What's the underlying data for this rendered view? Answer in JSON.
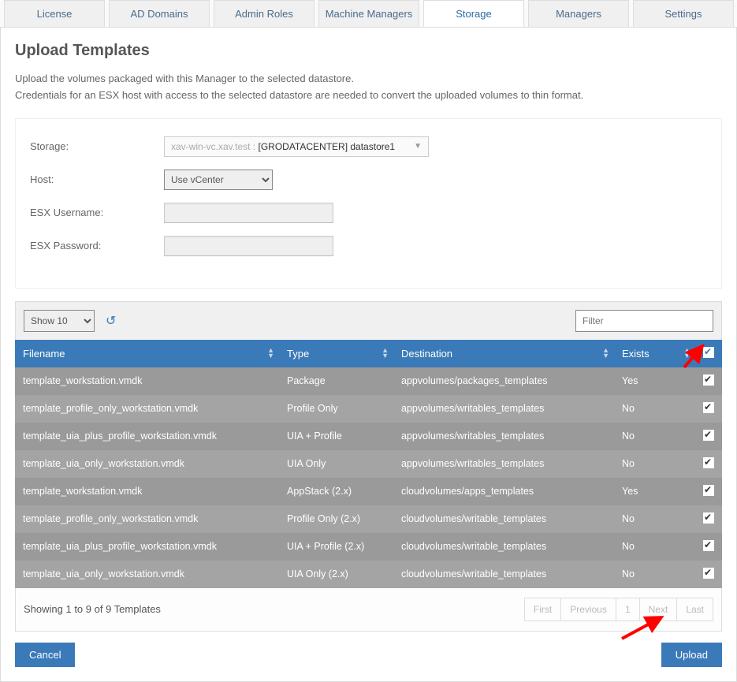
{
  "tabs": [
    "License",
    "AD Domains",
    "Admin Roles",
    "Machine Managers",
    "Storage",
    "Managers",
    "Settings"
  ],
  "activeTab": "Storage",
  "page": {
    "title": "Upload Templates",
    "desc1": "Upload the volumes packaged with this Manager to the selected datastore.",
    "desc2": "Credentials for an ESX host with access to the selected datastore are needed to convert the uploaded volumes to thin format."
  },
  "form": {
    "storageLabel": "Storage:",
    "storagePrefix": "xav-win-vc.xav.test :",
    "storageValue": "[GRODATACENTER] datastore1",
    "hostLabel": "Host:",
    "hostValue": "Use vCenter",
    "esxUserLabel": "ESX Username:",
    "esxUserValue": "",
    "esxPassLabel": "ESX Password:",
    "esxPassValue": ""
  },
  "toolbar": {
    "show": "Show 10",
    "filterPlaceholder": "Filter"
  },
  "columns": {
    "filename": "Filename",
    "type": "Type",
    "destination": "Destination",
    "exists": "Exists"
  },
  "rows": [
    {
      "f": "template_workstation.vmdk",
      "t": "Package",
      "d": "appvolumes/packages_templates",
      "e": "Yes",
      "c": true
    },
    {
      "f": "template_profile_only_workstation.vmdk",
      "t": "Profile Only",
      "d": "appvolumes/writables_templates",
      "e": "No",
      "c": true
    },
    {
      "f": "template_uia_plus_profile_workstation.vmdk",
      "t": "UIA + Profile",
      "d": "appvolumes/writables_templates",
      "e": "No",
      "c": true
    },
    {
      "f": "template_uia_only_workstation.vmdk",
      "t": "UIA Only",
      "d": "appvolumes/writables_templates",
      "e": "No",
      "c": true
    },
    {
      "f": "template_workstation.vmdk",
      "t": "AppStack (2.x)",
      "d": "cloudvolumes/apps_templates",
      "e": "Yes",
      "c": true
    },
    {
      "f": "template_profile_only_workstation.vmdk",
      "t": "Profile Only (2.x)",
      "d": "cloudvolumes/writable_templates",
      "e": "No",
      "c": true
    },
    {
      "f": "template_uia_plus_profile_workstation.vmdk",
      "t": "UIA + Profile (2.x)",
      "d": "cloudvolumes/writable_templates",
      "e": "No",
      "c": true
    },
    {
      "f": "template_uia_only_workstation.vmdk",
      "t": "UIA Only (2.x)",
      "d": "cloudvolumes/writable_templates",
      "e": "No",
      "c": true
    }
  ],
  "footer": {
    "info": "Showing 1 to 9 of 9 Templates",
    "pages": [
      "First",
      "Previous",
      "1",
      "Next",
      "Last"
    ]
  },
  "buttons": {
    "cancel": "Cancel",
    "upload": "Upload"
  }
}
